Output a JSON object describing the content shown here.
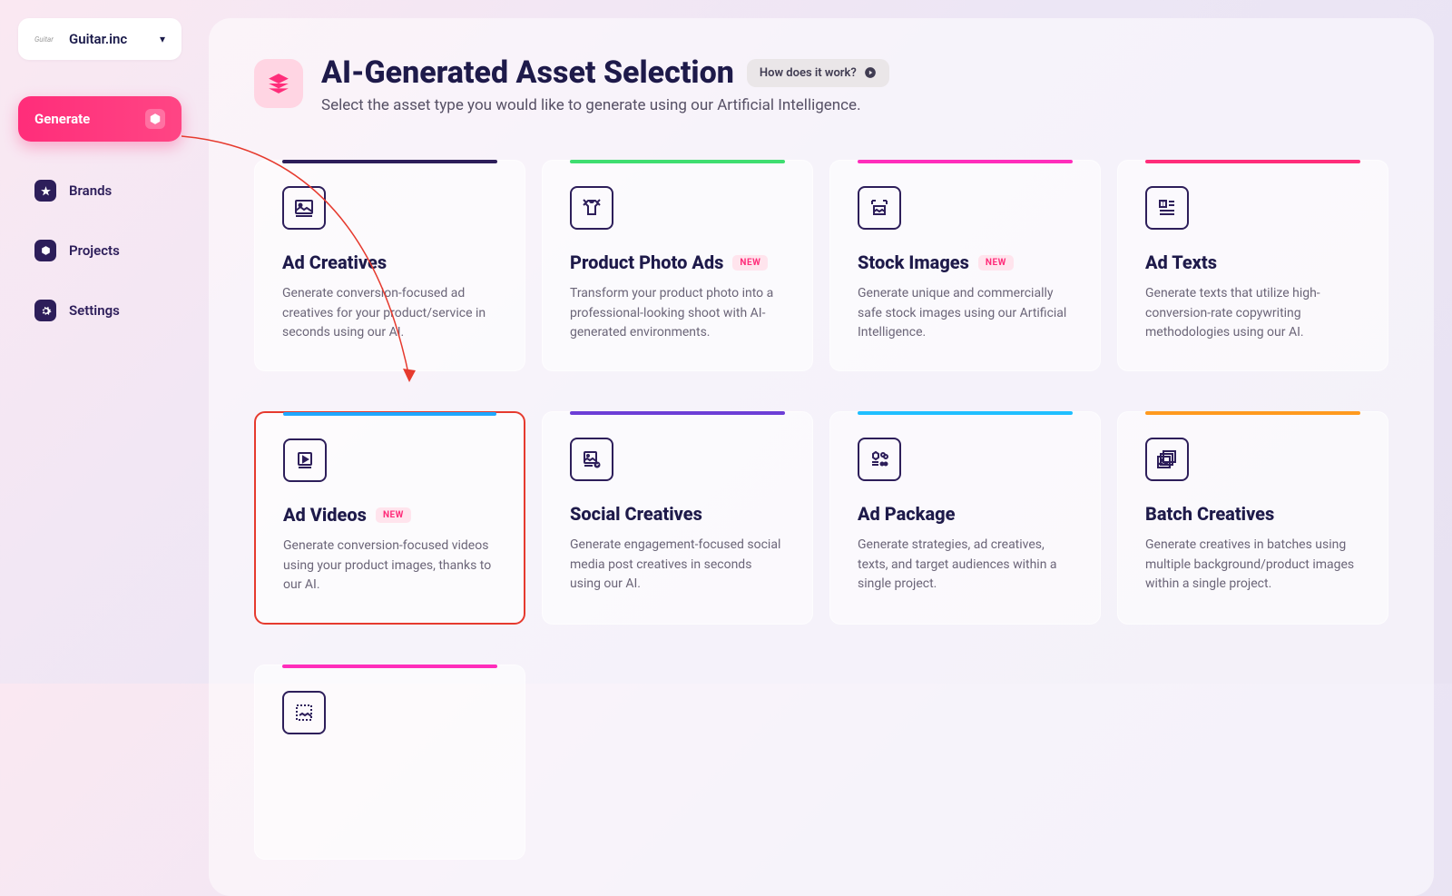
{
  "brand": {
    "name": "Guitar.inc",
    "logo_text": "Guitar"
  },
  "generate": {
    "label": "Generate"
  },
  "nav": [
    {
      "label": "Brands",
      "icon": "star"
    },
    {
      "label": "Projects",
      "icon": "cube"
    },
    {
      "label": "Settings",
      "icon": "gear"
    }
  ],
  "header": {
    "title": "AI-Generated Asset Selection",
    "subtitle": "Select the asset type you would like to generate using our Artificial Intelligence.",
    "help_label": "How does it work?"
  },
  "cards": [
    {
      "title": "Ad Creatives",
      "desc": "Generate conversion-focused ad creatives for your product/service in seconds using our AI.",
      "accent": "#2d1e5a",
      "new": false,
      "icon": "image",
      "highlighted": false
    },
    {
      "title": "Product Photo Ads",
      "desc": "Transform your product photo into a professional-looking shoot with AI-generated environments.",
      "accent": "#3fdd70",
      "new": true,
      "icon": "tshirt",
      "highlighted": false
    },
    {
      "title": "Stock Images",
      "desc": "Generate unique and commercially safe stock images using our Artificial Intelligence.",
      "accent": "#ff2dbb",
      "new": true,
      "icon": "picture",
      "highlighted": false
    },
    {
      "title": "Ad Texts",
      "desc": "Generate texts that utilize high-conversion-rate copywriting methodologies using our AI.",
      "accent": "#ff2d7a",
      "new": false,
      "icon": "text",
      "highlighted": false
    },
    {
      "title": "Ad Videos",
      "desc": "Generate conversion-focused videos using your product images, thanks to our AI.",
      "accent": "#1fa8ff",
      "new": true,
      "icon": "video",
      "highlighted": true
    },
    {
      "title": "Social Creatives",
      "desc": "Generate engagement-focused social media post creatives in seconds using our AI.",
      "accent": "#6d3ed6",
      "new": false,
      "icon": "social",
      "highlighted": false
    },
    {
      "title": "Ad Package",
      "desc": "Generate strategies, ad creatives, texts, and target audiences within a single project.",
      "accent": "#1fbfff",
      "new": false,
      "icon": "package",
      "highlighted": false
    },
    {
      "title": "Batch Creatives",
      "desc": "Generate creatives in batches using multiple background/product images within a single project.",
      "accent": "#ff9a1f",
      "new": false,
      "icon": "batch",
      "highlighted": false
    },
    {
      "title": "",
      "desc": "",
      "accent": "#ff2dbb",
      "new": false,
      "icon": "crop",
      "highlighted": false
    }
  ],
  "badge_text": "NEW"
}
